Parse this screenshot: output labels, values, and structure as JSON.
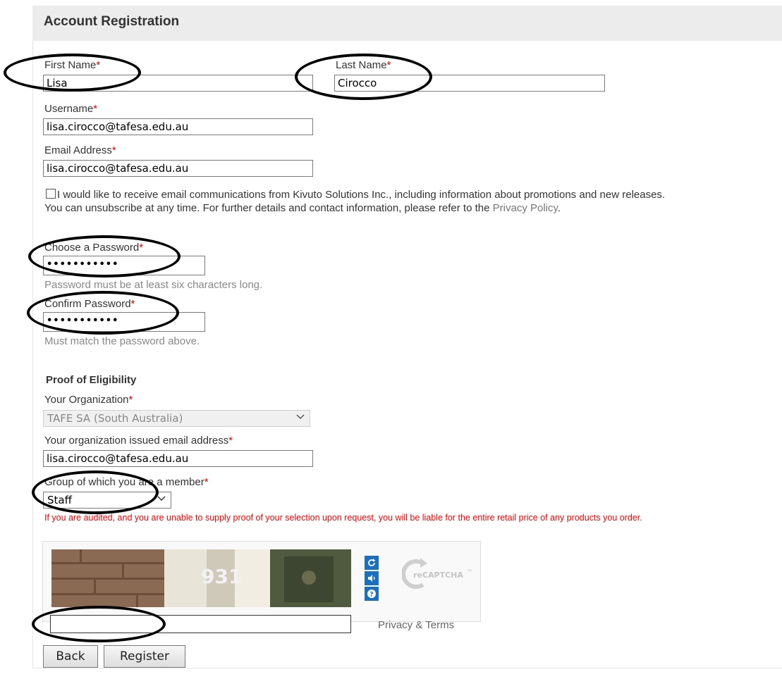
{
  "header": {
    "title": "Account Registration"
  },
  "required_mark": "*",
  "fields": {
    "first_name": {
      "label": "First Name",
      "value": "Lisa"
    },
    "last_name": {
      "label": "Last Name",
      "value": "Cirocco"
    },
    "username": {
      "label": "Username",
      "value": "lisa.cirocco@tafesa.edu.au"
    },
    "email": {
      "label": "Email Address",
      "value": "lisa.cirocco@tafesa.edu.au"
    },
    "password": {
      "label": "Choose a Password",
      "value": "•••••••••••",
      "hint": "Password must be at least six characters long."
    },
    "confirm_password": {
      "label": "Confirm Password",
      "value": "•••••••••••",
      "hint": "Must match the password above."
    }
  },
  "newsletter": {
    "checked": false,
    "text": "I would like to receive email communications from Kivuto Solutions Inc., including information about promotions and new releases.",
    "unsubscribe_text": "You can unsubscribe at any time. For further details and contact information, please refer to the",
    "privacy_link": "Privacy Policy",
    "period": "."
  },
  "eligibility": {
    "section_title": "Proof of Eligibility",
    "organization": {
      "label": "Your Organization",
      "value": "TAFE SA (South Australia)"
    },
    "org_email": {
      "label": "Your organization issued email address",
      "value": "lisa.cirocco@tafesa.edu.au"
    },
    "group": {
      "label": "Group of which you are a member",
      "value": "Staff"
    },
    "warning": "If you are audited, and you are unable to supply proof of your selection upon request, you will be liable for the entire retail price of any products you order."
  },
  "captcha": {
    "image_text": "931",
    "input_value": "",
    "privacy_terms": "Privacy & Terms",
    "logo_text": "reCAPTCHA",
    "logo_tm": "™",
    "refresh_icon": "refresh-icon",
    "audio_icon": "audio-icon",
    "help_icon": "help-icon"
  },
  "buttons": {
    "back": "Back",
    "register": "Register"
  },
  "colors": {
    "required": "#e00000",
    "warning": "#ff0000",
    "header_bg": "#ececec",
    "captcha_button": "#1a6fbf"
  }
}
